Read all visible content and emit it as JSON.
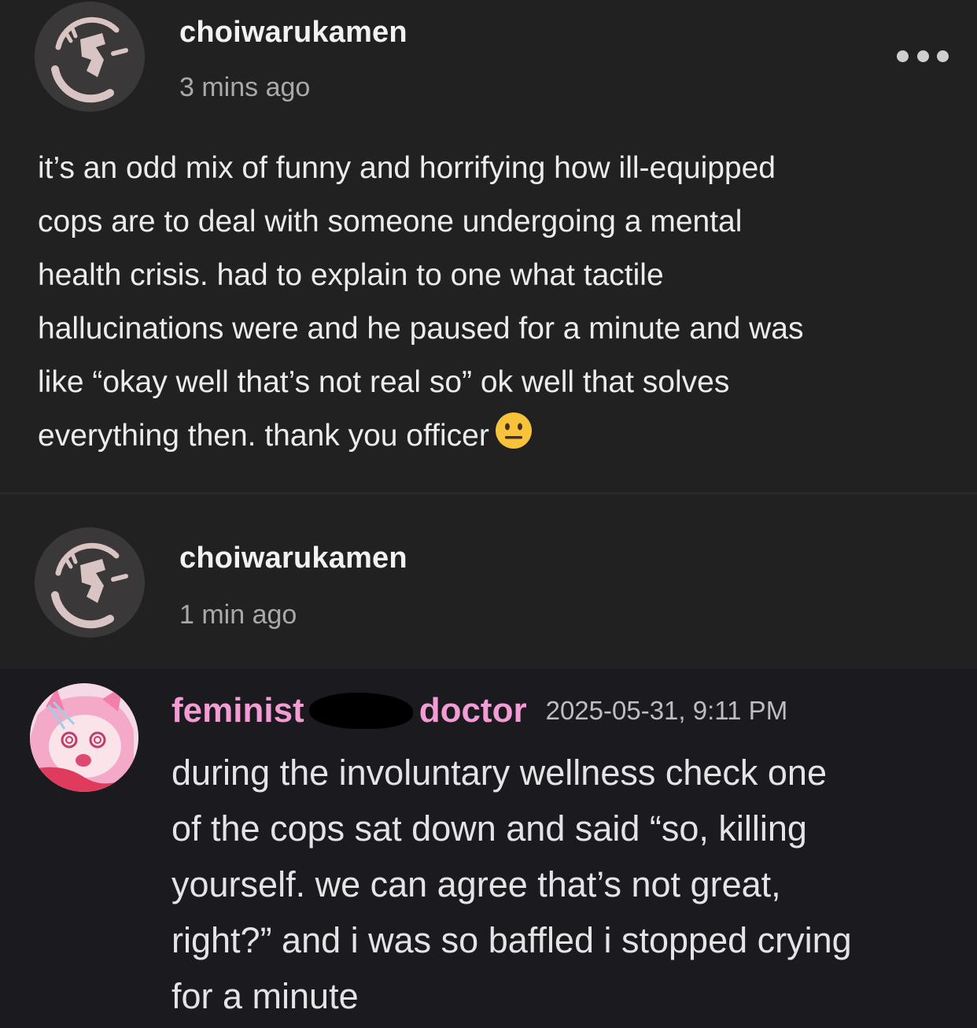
{
  "post_1": {
    "username": "choiwarukamen",
    "timestamp": "3 mins ago",
    "more_icon": "ellipsis-icon",
    "body_lines": [
      "it’s an odd mix of funny and horrifying how ill-equipped",
      "cops are to deal with someone undergoing a mental",
      "health crisis. had to explain to one what tactile",
      "hallucinations were and he paused for a minute and was",
      "like “okay well that’s not real so” ok well that solves",
      "everything then. thank you officer"
    ],
    "emoji": "neutral-face-emoji"
  },
  "post_2": {
    "username": "choiwarukamen",
    "timestamp": "1 min ago"
  },
  "discord_message": {
    "name_part_1": "feminist",
    "name_part_2": "doctor",
    "timestamp": "2025-05-31, 9:11 PM",
    "message_lines": [
      "during the involuntary wellness check one",
      "of the cops sat down and said “so, killing",
      "yourself. we can agree that’s not great,",
      "right?” and i was so baffled i stopped crying",
      "for a minute"
    ],
    "name_color": "#f39bd5"
  },
  "colors": {
    "post_background": "#212122",
    "discord_background": "#1a1a1f",
    "username_color": "#f2f2f2",
    "timestamp_color": "#a9a9a9"
  }
}
